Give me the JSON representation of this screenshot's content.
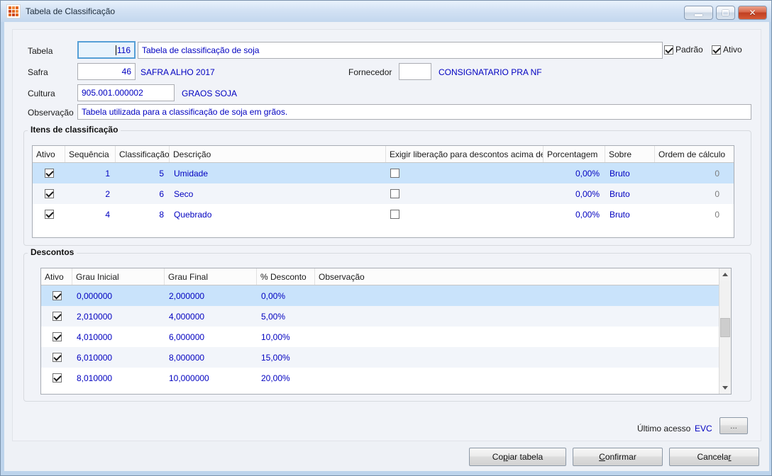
{
  "colors": {
    "accent_text": "#0000C0",
    "selection": "#C9E3FB",
    "frame_blue": "#BDD4EC",
    "close_red": "#C03F22"
  },
  "icons": {
    "app": "orange-grid-pattern",
    "minimize": "dash",
    "maximize": "square",
    "close": "✕",
    "scroll_up": "chevron-up",
    "scroll_down": "chevron-down"
  },
  "window": {
    "title": "Tabela de Classificação"
  },
  "form": {
    "tabela": {
      "label": "Tabela",
      "code": "116",
      "description": "Tabela de classificação de soja"
    },
    "padrao": {
      "label": "Padrão",
      "checked": true
    },
    "ativo": {
      "label": "Ativo",
      "checked": true
    },
    "safra": {
      "label": "Safra",
      "code": "46",
      "description": "SAFRA ALHO 2017"
    },
    "fornecedor": {
      "label": "Fornecedor",
      "code": "",
      "description": "CONSIGNATARIO PRA NF"
    },
    "cultura": {
      "label": "Cultura",
      "code": "905.001.000002",
      "description": "GRAOS SOJA"
    },
    "observacao": {
      "label": "Observação",
      "value": "Tabela utilizada para a classificação de soja em grãos."
    }
  },
  "itens": {
    "title": "Itens de classificação",
    "columns": [
      "Ativo",
      "Sequência",
      "Classificação",
      "Descrição",
      "Exigir liberação para descontos acima de",
      "Porcentagem",
      "Sobre",
      "Ordem de cálculo"
    ],
    "rows": [
      {
        "ativo": true,
        "sequencia": "1",
        "classificacao": "5",
        "descricao": "Umidade",
        "exigir": false,
        "porcentagem": "0,00%",
        "sobre": "Bruto",
        "ordem": "0"
      },
      {
        "ativo": true,
        "sequencia": "2",
        "classificacao": "6",
        "descricao": "Seco",
        "exigir": false,
        "porcentagem": "0,00%",
        "sobre": "Bruto",
        "ordem": "0"
      },
      {
        "ativo": true,
        "sequencia": "4",
        "classificacao": "8",
        "descricao": "Quebrado",
        "exigir": false,
        "porcentagem": "0,00%",
        "sobre": "Bruto",
        "ordem": "0"
      }
    ]
  },
  "descontos": {
    "title": "Descontos",
    "columns": [
      "Ativo",
      "Grau Inicial",
      "Grau Final",
      "% Desconto",
      "Observação"
    ],
    "rows": [
      {
        "ativo": true,
        "grau_inicial": "0,000000",
        "grau_final": "2,000000",
        "desconto": "0,00%",
        "observacao": ""
      },
      {
        "ativo": true,
        "grau_inicial": "2,010000",
        "grau_final": "4,000000",
        "desconto": "5,00%",
        "observacao": ""
      },
      {
        "ativo": true,
        "grau_inicial": "4,010000",
        "grau_final": "6,000000",
        "desconto": "10,00%",
        "observacao": ""
      },
      {
        "ativo": true,
        "grau_inicial": "6,010000",
        "grau_final": "8,000000",
        "desconto": "15,00%",
        "observacao": ""
      },
      {
        "ativo": true,
        "grau_inicial": "8,010000",
        "grau_final": "10,000000",
        "desconto": "20,00%",
        "observacao": ""
      }
    ]
  },
  "footer": {
    "ultimo_acesso_label": "Último acesso",
    "ultimo_acesso_value": "EVC",
    "more_label": "..."
  },
  "actions": {
    "copiar": {
      "pre": "Co",
      "key": "p",
      "post": "iar tabela"
    },
    "confirmar": {
      "pre": "",
      "key": "C",
      "post": "onfirmar"
    },
    "cancelar": {
      "pre": "Cancela",
      "key": "r",
      "post": ""
    }
  }
}
